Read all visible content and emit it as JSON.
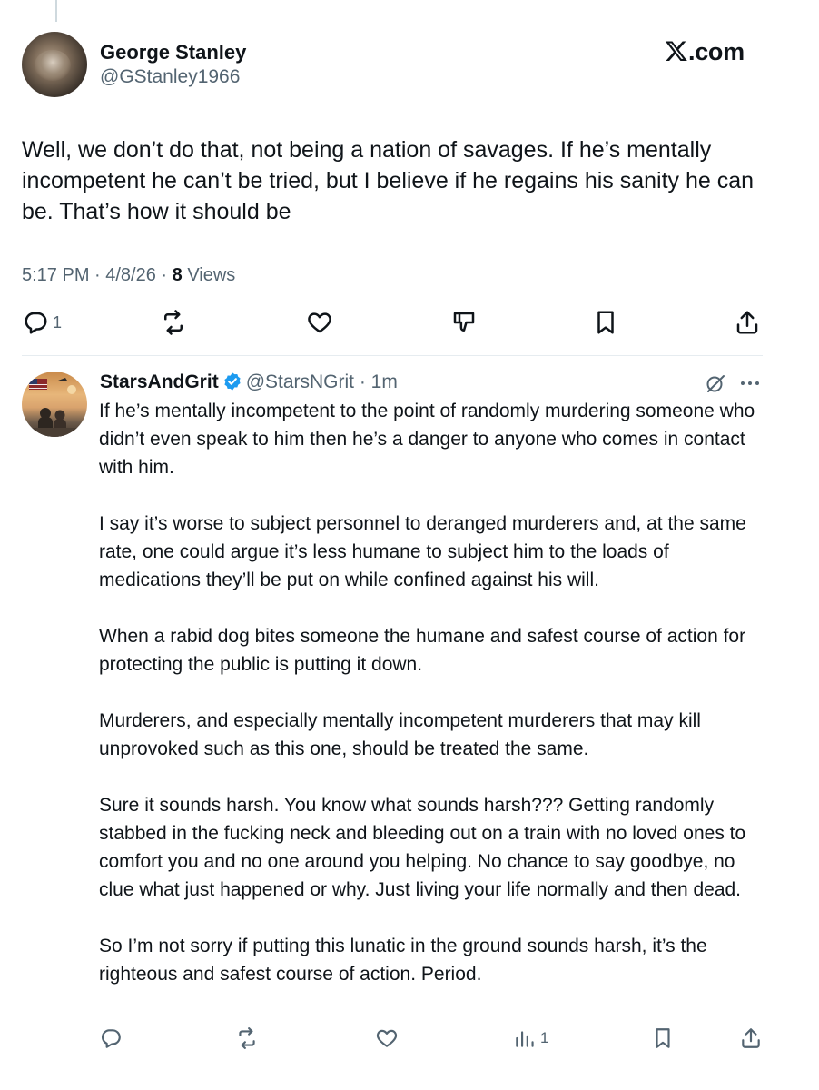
{
  "tweet": {
    "author_name": "George Stanley",
    "author_handle": "@GStanley1966",
    "site_label": ".com",
    "text": "Well, we don’t do that, not being a nation of savages. If he’s mentally incompetent he can’t be tried, but I believe if he regains his sanity he can be. That’s how it should be",
    "time": "5:17 PM · 4/8/26 · ",
    "views_count": "8",
    "views_label": " Views",
    "reply_count": "1"
  },
  "reply": {
    "author_name": "StarsAndGrit",
    "author_handle": "@StarsNGrit",
    "time": " · 1m",
    "paragraphs": [
      "If he’s mentally incompetent to the point of randomly murdering someone who didn’t even speak to him then he’s a danger to anyone who comes in contact with him.",
      "I say it’s worse to subject personnel to deranged murderers and, at the same rate, one could argue it’s less humane to subject him to the loads of medications they’ll be put on while confined against his will.",
      "When a rabid dog bites someone the humane and safest course of action for protecting the public is putting it down.",
      "Murderers, and especially mentally incompetent murderers that may kill unprovoked such as this one, should be treated the same.",
      "Sure it sounds harsh. You know what sounds harsh??? Getting randomly stabbed in the fucking neck and bleeding out on a train with no loved ones to comfort you and no one around you helping. No chance to say goodbye, no clue what just happened or why. Just living your life normally and then dead.",
      "So I’m not sorry if putting this lunatic in the ground sounds harsh, it’s the righteous and safest course of action.  Period."
    ],
    "views_count": "1"
  },
  "colors": {
    "verified": "#1d9bf0",
    "muted": "#536471",
    "text": "#0f1419"
  },
  "icons": [
    "reply-icon",
    "retweet-icon",
    "like-icon",
    "dislike-icon",
    "bookmark-icon",
    "share-icon",
    "grok-icon",
    "more-icon",
    "views-icon",
    "verified-badge-icon",
    "x-logo-icon"
  ]
}
